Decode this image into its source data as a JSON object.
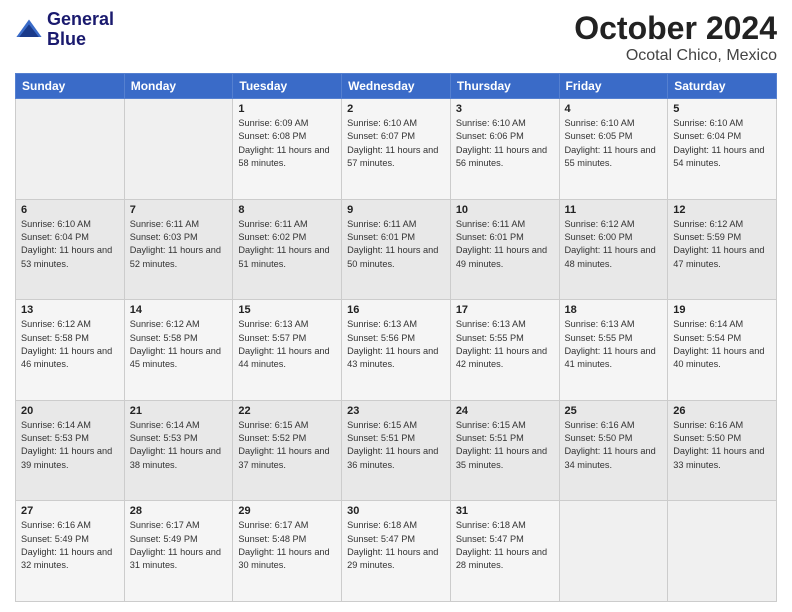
{
  "header": {
    "logo_line1": "General",
    "logo_line2": "Blue",
    "month": "October 2024",
    "location": "Ocotal Chico, Mexico"
  },
  "weekdays": [
    "Sunday",
    "Monday",
    "Tuesday",
    "Wednesday",
    "Thursday",
    "Friday",
    "Saturday"
  ],
  "weeks": [
    [
      {
        "day": "",
        "info": ""
      },
      {
        "day": "",
        "info": ""
      },
      {
        "day": "1",
        "info": "Sunrise: 6:09 AM\nSunset: 6:08 PM\nDaylight: 11 hours and 58 minutes."
      },
      {
        "day": "2",
        "info": "Sunrise: 6:10 AM\nSunset: 6:07 PM\nDaylight: 11 hours and 57 minutes."
      },
      {
        "day": "3",
        "info": "Sunrise: 6:10 AM\nSunset: 6:06 PM\nDaylight: 11 hours and 56 minutes."
      },
      {
        "day": "4",
        "info": "Sunrise: 6:10 AM\nSunset: 6:05 PM\nDaylight: 11 hours and 55 minutes."
      },
      {
        "day": "5",
        "info": "Sunrise: 6:10 AM\nSunset: 6:04 PM\nDaylight: 11 hours and 54 minutes."
      }
    ],
    [
      {
        "day": "6",
        "info": "Sunrise: 6:10 AM\nSunset: 6:04 PM\nDaylight: 11 hours and 53 minutes."
      },
      {
        "day": "7",
        "info": "Sunrise: 6:11 AM\nSunset: 6:03 PM\nDaylight: 11 hours and 52 minutes."
      },
      {
        "day": "8",
        "info": "Sunrise: 6:11 AM\nSunset: 6:02 PM\nDaylight: 11 hours and 51 minutes."
      },
      {
        "day": "9",
        "info": "Sunrise: 6:11 AM\nSunset: 6:01 PM\nDaylight: 11 hours and 50 minutes."
      },
      {
        "day": "10",
        "info": "Sunrise: 6:11 AM\nSunset: 6:01 PM\nDaylight: 11 hours and 49 minutes."
      },
      {
        "day": "11",
        "info": "Sunrise: 6:12 AM\nSunset: 6:00 PM\nDaylight: 11 hours and 48 minutes."
      },
      {
        "day": "12",
        "info": "Sunrise: 6:12 AM\nSunset: 5:59 PM\nDaylight: 11 hours and 47 minutes."
      }
    ],
    [
      {
        "day": "13",
        "info": "Sunrise: 6:12 AM\nSunset: 5:58 PM\nDaylight: 11 hours and 46 minutes."
      },
      {
        "day": "14",
        "info": "Sunrise: 6:12 AM\nSunset: 5:58 PM\nDaylight: 11 hours and 45 minutes."
      },
      {
        "day": "15",
        "info": "Sunrise: 6:13 AM\nSunset: 5:57 PM\nDaylight: 11 hours and 44 minutes."
      },
      {
        "day": "16",
        "info": "Sunrise: 6:13 AM\nSunset: 5:56 PM\nDaylight: 11 hours and 43 minutes."
      },
      {
        "day": "17",
        "info": "Sunrise: 6:13 AM\nSunset: 5:55 PM\nDaylight: 11 hours and 42 minutes."
      },
      {
        "day": "18",
        "info": "Sunrise: 6:13 AM\nSunset: 5:55 PM\nDaylight: 11 hours and 41 minutes."
      },
      {
        "day": "19",
        "info": "Sunrise: 6:14 AM\nSunset: 5:54 PM\nDaylight: 11 hours and 40 minutes."
      }
    ],
    [
      {
        "day": "20",
        "info": "Sunrise: 6:14 AM\nSunset: 5:53 PM\nDaylight: 11 hours and 39 minutes."
      },
      {
        "day": "21",
        "info": "Sunrise: 6:14 AM\nSunset: 5:53 PM\nDaylight: 11 hours and 38 minutes."
      },
      {
        "day": "22",
        "info": "Sunrise: 6:15 AM\nSunset: 5:52 PM\nDaylight: 11 hours and 37 minutes."
      },
      {
        "day": "23",
        "info": "Sunrise: 6:15 AM\nSunset: 5:51 PM\nDaylight: 11 hours and 36 minutes."
      },
      {
        "day": "24",
        "info": "Sunrise: 6:15 AM\nSunset: 5:51 PM\nDaylight: 11 hours and 35 minutes."
      },
      {
        "day": "25",
        "info": "Sunrise: 6:16 AM\nSunset: 5:50 PM\nDaylight: 11 hours and 34 minutes."
      },
      {
        "day": "26",
        "info": "Sunrise: 6:16 AM\nSunset: 5:50 PM\nDaylight: 11 hours and 33 minutes."
      }
    ],
    [
      {
        "day": "27",
        "info": "Sunrise: 6:16 AM\nSunset: 5:49 PM\nDaylight: 11 hours and 32 minutes."
      },
      {
        "day": "28",
        "info": "Sunrise: 6:17 AM\nSunset: 5:49 PM\nDaylight: 11 hours and 31 minutes."
      },
      {
        "day": "29",
        "info": "Sunrise: 6:17 AM\nSunset: 5:48 PM\nDaylight: 11 hours and 30 minutes."
      },
      {
        "day": "30",
        "info": "Sunrise: 6:18 AM\nSunset: 5:47 PM\nDaylight: 11 hours and 29 minutes."
      },
      {
        "day": "31",
        "info": "Sunrise: 6:18 AM\nSunset: 5:47 PM\nDaylight: 11 hours and 28 minutes."
      },
      {
        "day": "",
        "info": ""
      },
      {
        "day": "",
        "info": ""
      }
    ]
  ]
}
